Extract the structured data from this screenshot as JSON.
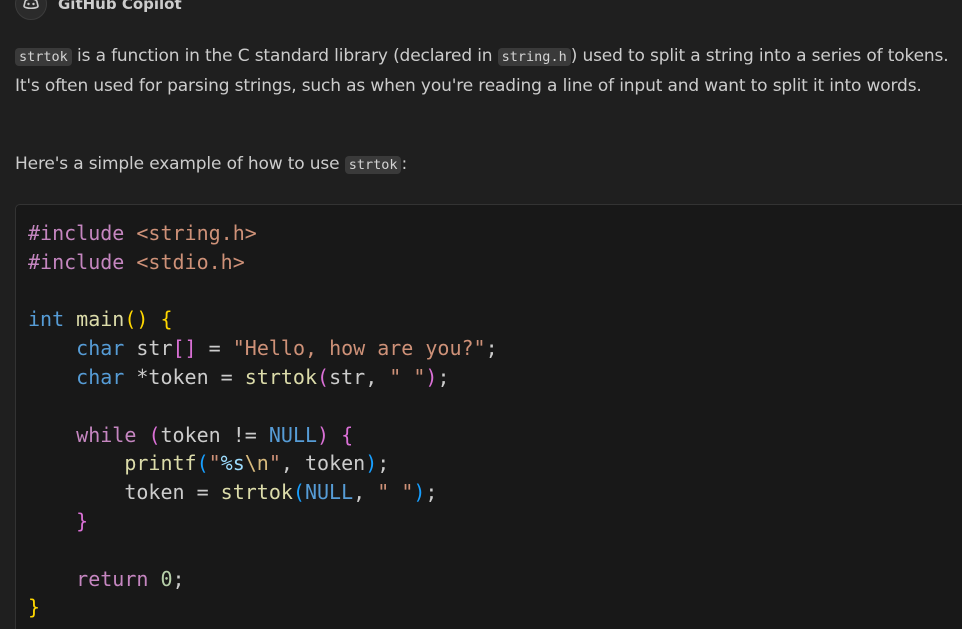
{
  "header": {
    "author": "GitHub Copilot",
    "avatar_icon": "copilot-icon"
  },
  "message": {
    "p1": {
      "code1": "strtok",
      "text1": " is a function in the C standard library (declared in ",
      "code2": "string.h",
      "text2": ") used to split a string into a series of tokens. It's often used for parsing strings, such as when you're reading a line of input and want to split it into words."
    },
    "p2": {
      "text1": "Here's a simple example of how to use ",
      "code1": "strtok",
      "text2": ":"
    }
  },
  "code": {
    "language": "c",
    "lines": [
      "#include <string.h>",
      "#include <stdio.h>",
      "",
      "int main() {",
      "    char str[] = \"Hello, how are you?\";",
      "    char *token = strtok(str, \" \");",
      "",
      "    while (token != NULL) {",
      "        printf(\"%s\\n\", token);",
      "        token = strtok(NULL, \" \");",
      "    }",
      "",
      "    return 0;",
      "}"
    ],
    "tokens": {
      "l1_pre": "#include",
      "l1_inc": "<string.h>",
      "l2_pre": "#include",
      "l2_inc": "<stdio.h>",
      "l4_type": "int",
      "l4_fn": "main",
      "l5_type": "char",
      "l5_var": "str",
      "l5_str": "\"Hello, how are you?\"",
      "l6_type": "char",
      "l6_var": "*token",
      "l6_fn": "strtok",
      "l6_arg": "str",
      "l6_str": "\" \"",
      "l8_kw": "while",
      "l8_var": "token",
      "l8_null": "NULL",
      "l9_fn": "printf",
      "l9_fmt": "%s",
      "l9_esc": "\\n",
      "l9_var": "token",
      "l10_var": "token",
      "l10_fn": "strtok",
      "l10_null": "NULL",
      "l10_str": "\" \"",
      "l13_kw": "return",
      "l13_num": "0"
    }
  },
  "colors": {
    "background": "#1f1f1f",
    "code_background": "#181818",
    "text": "#cccccc",
    "keyword": "#c586c0",
    "type": "#569cd6",
    "function": "#dcdcaa",
    "string": "#ce9178",
    "number": "#b5cea8"
  }
}
